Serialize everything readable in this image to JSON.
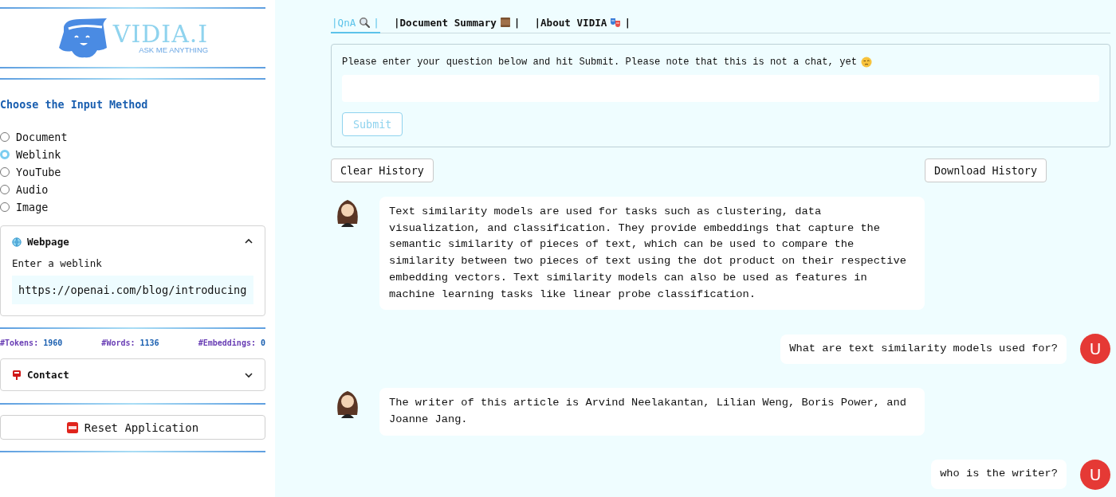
{
  "sidebar": {
    "logo": {
      "name": "VIDIA.I",
      "tagline": "ASK ME ANYTHING"
    },
    "input_method": {
      "heading": "Choose the Input Method",
      "options": [
        {
          "label": "Document",
          "selected": false
        },
        {
          "label": "Weblink",
          "selected": true
        },
        {
          "label": "YouTube",
          "selected": false
        },
        {
          "label": "Audio",
          "selected": false
        },
        {
          "label": "Image",
          "selected": false
        }
      ]
    },
    "webpage_panel": {
      "title": "Webpage",
      "expanded": true,
      "field_label": "Enter a weblink",
      "value": "https://openai.com/blog/introducing"
    },
    "stats": [
      {
        "label": "#Tokens:",
        "value": "1960"
      },
      {
        "label": "#Words:",
        "value": "1136"
      },
      {
        "label": "#Embeddings:",
        "value": "0"
      }
    ],
    "contact_panel": {
      "title": "Contact",
      "expanded": false
    },
    "reset_button": "Reset Application"
  },
  "main": {
    "tabs": [
      {
        "label": "|QnA",
        "kind": "search",
        "end": "|",
        "selected": true
      },
      {
        "label": "|Document Summary",
        "kind": "scroll",
        "end": "|",
        "selected": false
      },
      {
        "label": "|About VIDIA",
        "kind": "masks",
        "end": "|",
        "selected": false
      }
    ],
    "question_form": {
      "prompt": "Please enter your question below and hit Submit. Please note that this is not a chat, yet",
      "submit": {
        "label": "Submit",
        "disabled": true
      }
    },
    "clear_button": "Clear History",
    "download_button": "Download History",
    "messages": [
      {
        "kind": "bot",
        "text": "Text similarity models are used for tasks such as clustering, data visualization, and classification. They provide embeddings that capture the semantic similarity of pieces of text, which can be used to compare the similarity between two pieces of text using the dot product on their respective embedding vectors. Text similarity models can also be used as features in machine learning tasks like linear probe classification."
      },
      {
        "kind": "user",
        "text": "What are text similarity models used for?",
        "avatar": "U"
      },
      {
        "kind": "bot",
        "text": "The writer of this article is Arvind Neelakantan, Lilian Weng, Boris Power, and Joanne Jang."
      },
      {
        "kind": "user",
        "text": "who is the writer?",
        "avatar": "U"
      }
    ]
  }
}
